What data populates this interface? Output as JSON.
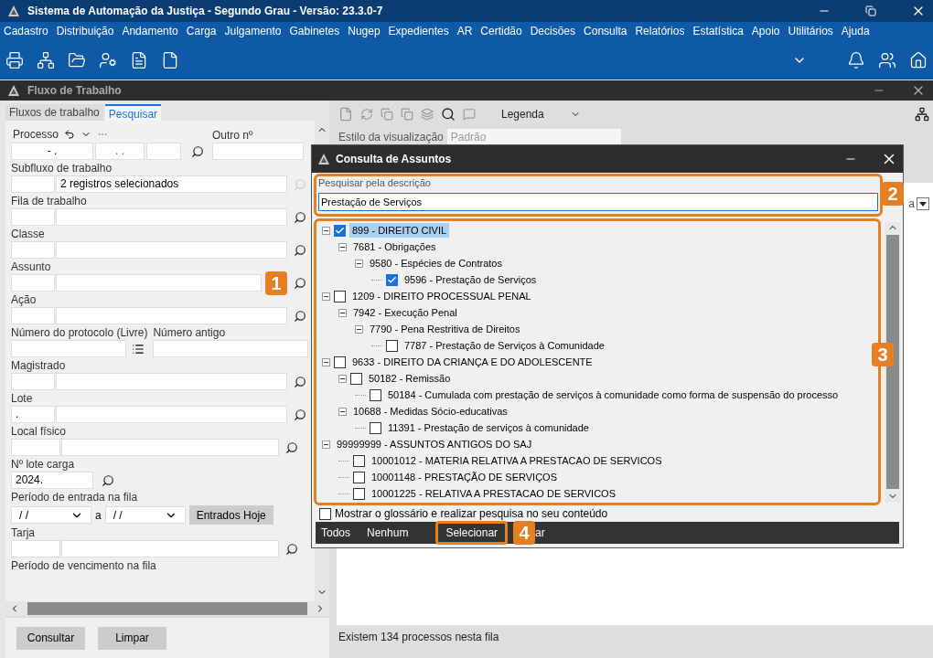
{
  "window": {
    "title": "Sistema de Automação da Justiça - Segundo Grau - Versão: 23.3.0-7"
  },
  "menu": [
    "Cadastro",
    "Distribuição",
    "Andamento",
    "Carga",
    "Julgamento",
    "Gabinetes",
    "Nugep",
    "Expedientes",
    "AR",
    "Certidão",
    "Decisões",
    "Consulta",
    "Relatórios",
    "Estatística",
    "Apoio",
    "Utilitários",
    "Ajuda"
  ],
  "workspace": {
    "title": "Fluxo de Trabalho"
  },
  "tabs": [
    {
      "label": "Fluxos de trabalho",
      "selected": false
    },
    {
      "label": "Pesquisar",
      "selected": true
    }
  ],
  "process": {
    "label": "Processo",
    "segments": [
      "- .",
      ". ."
    ],
    "other_label": "Outro nº"
  },
  "fields": [
    {
      "kind": "lookup",
      "label": "Subfluxo de trabalho",
      "value": "2 registros selecionados",
      "disabled": true
    },
    {
      "kind": "lookup",
      "label": "Fila de trabalho",
      "disabled": false
    },
    {
      "kind": "lookup",
      "label": "Classe",
      "disabled": false
    },
    {
      "kind": "lookup",
      "label": "Assunto",
      "disabled": false,
      "annotation": "1"
    },
    {
      "kind": "lookup",
      "label": "Ação",
      "disabled": false
    },
    {
      "kind": "pair",
      "label": "Número do protocolo (Livre)",
      "label_2": "Número antigo"
    },
    {
      "kind": "lookup",
      "label": "Magistrado",
      "disabled": false
    },
    {
      "kind": "lookup",
      "label": "Lote",
      "code": ".",
      "disabled": false
    },
    {
      "kind": "short",
      "label": "Local físico",
      "disabled": false
    },
    {
      "kind": "single",
      "label": "Nº lote carga",
      "value": "2024."
    },
    {
      "kind": "dates",
      "label": "Período de entrada na fila",
      "from": "/ /",
      "separator": "a",
      "to": "/ /",
      "button": "Entrados Hoje"
    },
    {
      "kind": "short",
      "label": "Tarja",
      "disabled": false
    },
    {
      "kind": "caption",
      "label": "Período de vencimento na fila"
    }
  ],
  "form_buttons": [
    "Consultar",
    "Limpar"
  ],
  "results": {
    "legend": "Legenda",
    "view_style_label": "Estilo da visualização",
    "view_style": "Padrão",
    "column_fragment": "a",
    "status": "Existem 134 processos nesta fila"
  },
  "dialog": {
    "title": "Consulta de Assuntos",
    "search_label": "Pesquisar pela descrição",
    "search_value": "Prestação de Serviços",
    "search_annotation": "2",
    "tree_annotation": "3",
    "tree": [
      {
        "label": "899 - DIREITO CIVIL",
        "kind": "checkable",
        "checked": true,
        "selected": true,
        "expanded": true,
        "children": [
          {
            "label": "7681 - Obrigações",
            "kind": "plain",
            "selected": false,
            "expanded": true,
            "children": [
              {
                "label": "9580 - Espécies de Contratos",
                "kind": "plain",
                "selected": false,
                "expanded": true,
                "children": [
                  {
                    "label": "9596 - Prestação de Serviços",
                    "kind": "checkable",
                    "checked": true,
                    "selected": false
                  }
                ]
              }
            ]
          }
        ]
      },
      {
        "label": "1209 - DIREITO PROCESSUAL PENAL",
        "kind": "checkable",
        "checked": false,
        "selected": false,
        "expanded": true,
        "children": [
          {
            "label": "7942 - Execução Penal",
            "kind": "plain",
            "selected": false,
            "expanded": true,
            "children": [
              {
                "label": "7790 - Pena Restritiva de Direitos",
                "kind": "plain",
                "selected": false,
                "expanded": true,
                "children": [
                  {
                    "label": "7787 - Prestação de Serviços à Comunidade",
                    "kind": "checkable",
                    "checked": false,
                    "selected": false
                  }
                ]
              }
            ]
          }
        ]
      },
      {
        "label": "9633 - DIREITO DA CRIANÇA E DO ADOLESCENTE",
        "kind": "checkable",
        "checked": false,
        "selected": false,
        "expanded": true,
        "children": [
          {
            "label": "50182 - Remissão",
            "kind": "checkable",
            "checked": false,
            "selected": false,
            "expanded": true,
            "children": [
              {
                "label": "50184 - Cumulada com prestação de serviços à comunidade como forma de suspensão do processo",
                "kind": "checkable",
                "checked": false,
                "selected": false
              }
            ]
          },
          {
            "label": "10688 - Medidas Sócio-educativas",
            "kind": "plain",
            "selected": false,
            "expanded": true,
            "children": [
              {
                "label": "11391 - Prestação de serviços à comunidade",
                "kind": "checkable",
                "checked": false,
                "selected": false
              }
            ]
          }
        ]
      },
      {
        "label": "99999999 - ASSUNTOS ANTIGOS DO SAJ",
        "kind": "plain",
        "selected": false,
        "expanded": true,
        "children": [
          {
            "label": "10001012 - MATERIA RELATIVA A PRESTACAO DE SERVICOS",
            "kind": "checkable",
            "checked": false,
            "selected": false
          },
          {
            "label": "10001148 - PRESTAÇÃO DE SERVIÇOS",
            "kind": "checkable",
            "checked": false,
            "selected": false
          },
          {
            "label": "10001225 - RELATIVA A PRESTACAO DE SERVICOS",
            "kind": "checkable",
            "checked": false,
            "selected": false
          }
        ]
      }
    ],
    "glossary": {
      "label": "Mostrar o glossário e realizar pesquisa no seu conteúdo",
      "checked": false
    },
    "buttons": [
      {
        "label": "Todos",
        "kind": "plain"
      },
      {
        "label": "Nenhum",
        "kind": "plain"
      },
      {
        "label": "Selecionar",
        "kind": "highlighted",
        "annotation": "4"
      },
      {
        "label": "ar",
        "kind": "plain"
      }
    ]
  }
}
